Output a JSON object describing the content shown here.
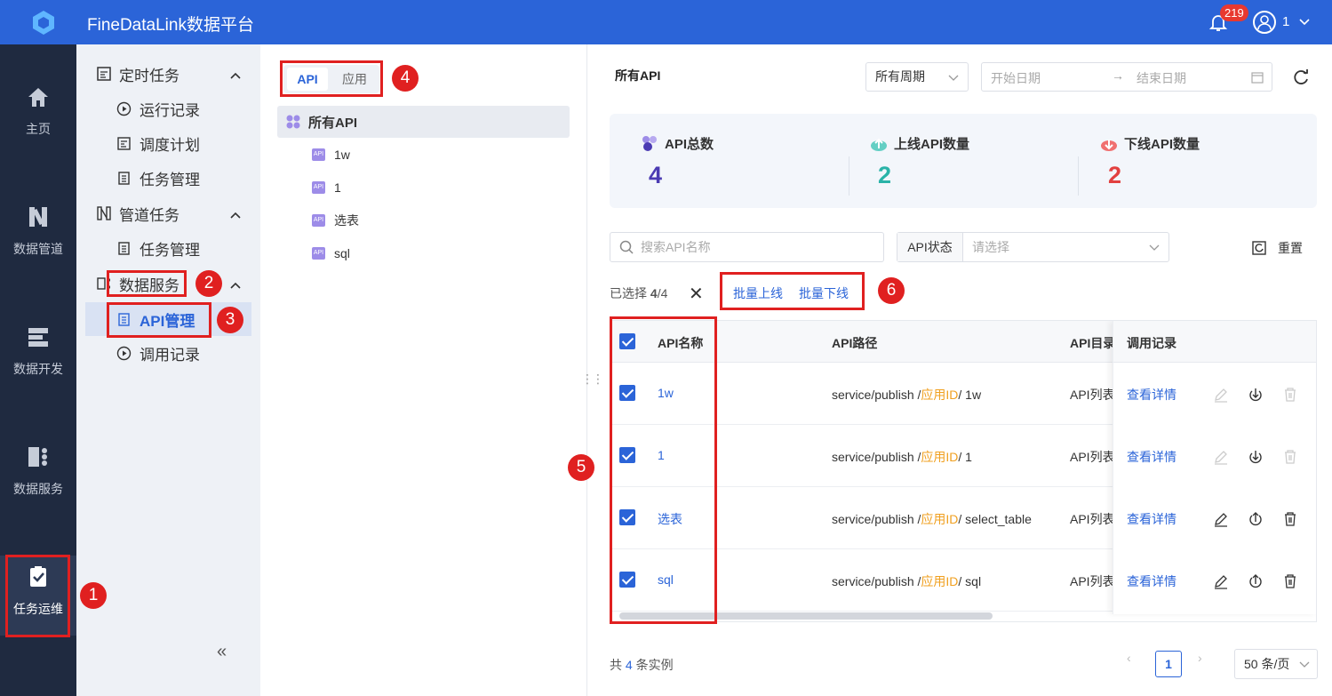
{
  "app": {
    "title": "FineDataLink数据平台",
    "notification_count": "219",
    "user": "1"
  },
  "leftnav": [
    {
      "label": "主页",
      "icon": "home-icon"
    },
    {
      "label": "数据管道",
      "icon": "pipeline-icon"
    },
    {
      "label": "数据开发",
      "icon": "dev-icon"
    },
    {
      "label": "数据服务",
      "icon": "service-icon"
    },
    {
      "label": "任务运维",
      "icon": "task-ops-icon"
    }
  ],
  "collapse_label": "«",
  "subnav": {
    "groups": [
      {
        "label": "定时任务",
        "items": [
          "运行记录",
          "调度计划",
          "任务管理"
        ]
      },
      {
        "label": "管道任务",
        "items": [
          "任务管理"
        ]
      },
      {
        "label": "数据服务",
        "items": [
          "API管理",
          "调用记录"
        ]
      }
    ],
    "selected": "API管理"
  },
  "tree": {
    "tabs": [
      "API",
      "应用"
    ],
    "root": "所有API",
    "items": [
      "1w",
      "1",
      "选表",
      "sql"
    ],
    "tag": "API"
  },
  "main": {
    "title": "所有API",
    "period": "所有周期",
    "start_placeholder": "开始日期",
    "end_placeholder": "结束日期"
  },
  "stats": [
    {
      "label": "API总数",
      "value": "4",
      "color": "#4b3bb3"
    },
    {
      "label": "上线API数量",
      "value": "2",
      "color": "#2ab3a8"
    },
    {
      "label": "下线API数量",
      "value": "2",
      "color": "#e2403f"
    }
  ],
  "filters": {
    "search_placeholder": "搜索API名称",
    "status_label": "API状态",
    "status_placeholder": "请选择",
    "reset": "重置"
  },
  "selection": {
    "prefix": "已选择 ",
    "count": "4",
    "total": "/4",
    "bulk_online": "批量上线",
    "bulk_offline": "批量下线"
  },
  "table": {
    "headers": [
      "API名称",
      "API路径",
      "API目录",
      "调用记录"
    ],
    "rows": [
      {
        "name": "1w",
        "path_prefix": "service/publish /",
        "path_id": "应用ID",
        "path_suffix": "/ 1w",
        "dir": "API列表",
        "record": "查看详情"
      },
      {
        "name": "1",
        "path_prefix": "service/publish /",
        "path_id": "应用ID",
        "path_suffix": "/ 1",
        "dir": "API列表",
        "record": "查看详情"
      },
      {
        "name": "选表",
        "path_prefix": "service/publish /",
        "path_id": "应用ID",
        "path_suffix": "/ select_table",
        "dir": "API列表",
        "record": "查看详情"
      },
      {
        "name": "sql",
        "path_prefix": "service/publish /",
        "path_id": "应用ID",
        "path_suffix": "/ sql",
        "dir": "API列表",
        "record": "查看详情"
      }
    ]
  },
  "footer": {
    "total_prefix": "共 ",
    "total_count": "4",
    "total_suffix": " 条实例",
    "page": "1",
    "page_size": "50 条/页"
  },
  "annotations": [
    "1",
    "2",
    "3",
    "4",
    "5",
    "6"
  ]
}
